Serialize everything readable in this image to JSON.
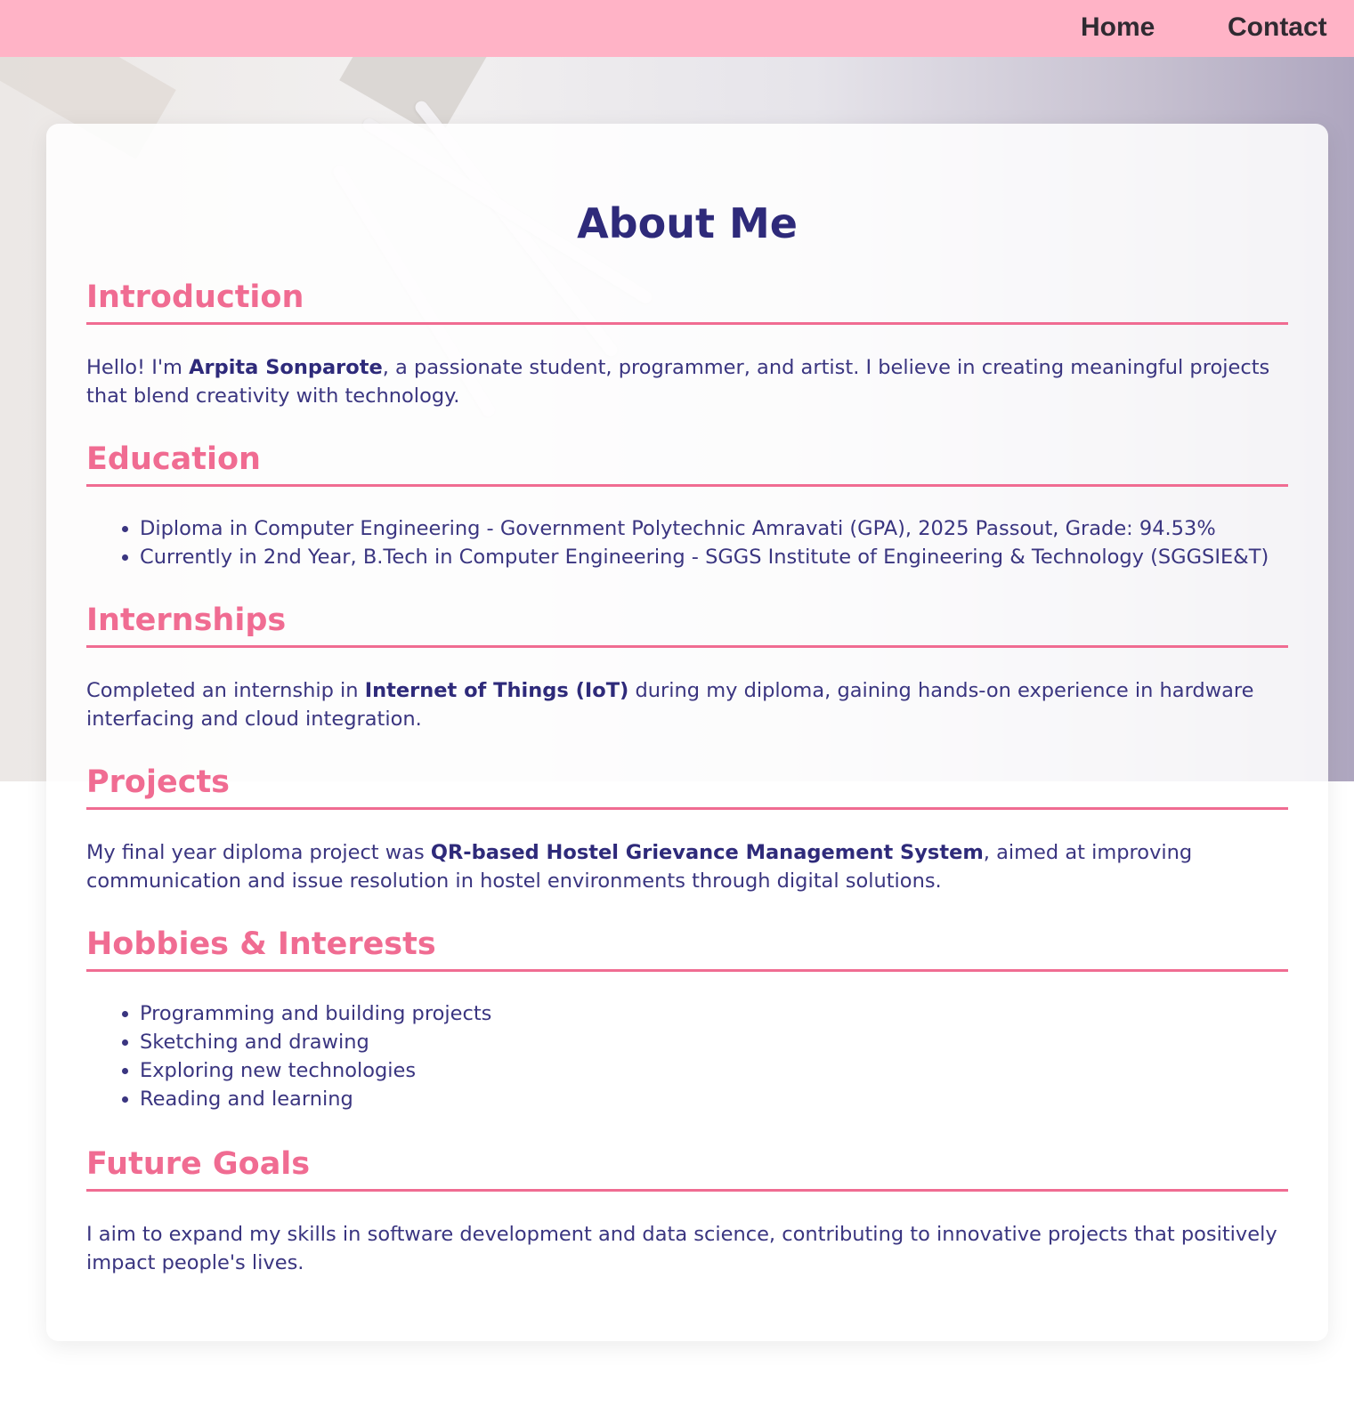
{
  "nav": {
    "home": "Home",
    "contact": "Contact"
  },
  "page": {
    "title": "About Me"
  },
  "sections": {
    "introduction": {
      "heading": "Introduction",
      "prefix": "Hello! I'm ",
      "name": "Arpita Sonparote",
      "suffix": ", a passionate student, programmer, and artist. I believe in creating meaningful projects that blend creativity with technology."
    },
    "education": {
      "heading": "Education",
      "items": [
        "Diploma in Computer Engineering - Government Polytechnic Amravati (GPA), 2025 Passout, Grade: 94.53%",
        "Currently in 2nd Year, B.Tech in Computer Engineering - SGGS Institute of Engineering & Technology (SGGSIE&T)"
      ]
    },
    "internships": {
      "heading": "Internships",
      "prefix": "Completed an internship in ",
      "highlight": "Internet of Things (IoT)",
      "suffix": " during my diploma, gaining hands-on experience in hardware interfacing and cloud integration."
    },
    "projects": {
      "heading": "Projects",
      "prefix": "My final year diploma project was ",
      "highlight": "QR-based Hostel Grievance Management System",
      "suffix": ", aimed at improving communication and issue resolution in hostel environments through digital solutions."
    },
    "hobbies": {
      "heading": "Hobbies & Interests",
      "items": [
        "Programming and building projects",
        "Sketching and drawing",
        "Exploring new technologies",
        "Reading and learning"
      ]
    },
    "goals": {
      "heading": "Future Goals",
      "text": "I aim to expand my skills in software development and data science, contributing to innovative projects that positively impact people's lives."
    }
  },
  "colors": {
    "nav_bg": "#ffb3c6",
    "heading_pink": "#f06c92",
    "title_navy": "#2e2a7a",
    "body_text": "#3a3580"
  }
}
